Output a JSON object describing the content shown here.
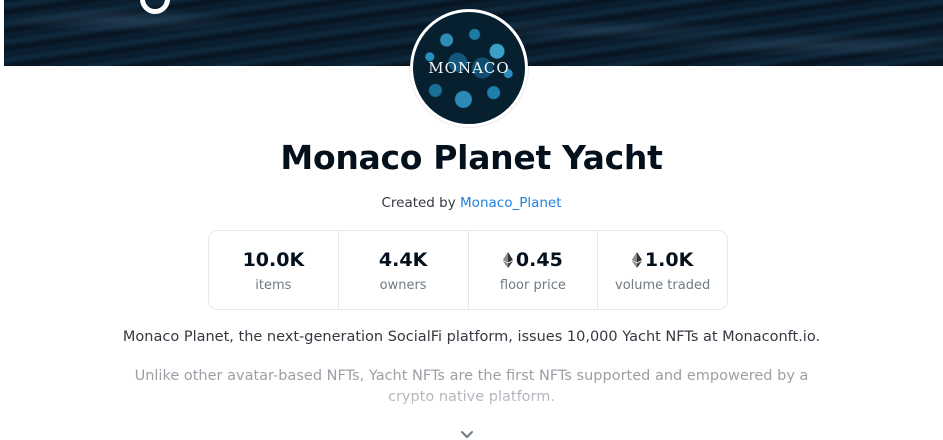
{
  "collection": {
    "name": "Monaco Planet Yacht",
    "created_by_prefix": "Created by",
    "creator": "Monaco_Planet",
    "avatar_text": "MONACO"
  },
  "stats": [
    {
      "value": "10.0K",
      "label": "items",
      "eth": false
    },
    {
      "value": "4.4K",
      "label": "owners",
      "eth": false
    },
    {
      "value": "0.45",
      "label": "floor price",
      "eth": true
    },
    {
      "value": "1.0K",
      "label": "volume traded",
      "eth": true
    }
  ],
  "description": {
    "line1": "Monaco Planet, the next-generation SocialFi platform, issues 10,000 Yacht NFTs at Monaconft.io.",
    "line2": "Unlike other avatar-based NFTs, Yacht NFTs are the first NFTs supported and empowered by a crypto native platform."
  },
  "icons": {
    "eth": "ethereum-icon",
    "expand": "chevron-down-icon"
  },
  "colors": {
    "link": "#2081e2",
    "title": "#04111d",
    "muted": "#707a83"
  }
}
